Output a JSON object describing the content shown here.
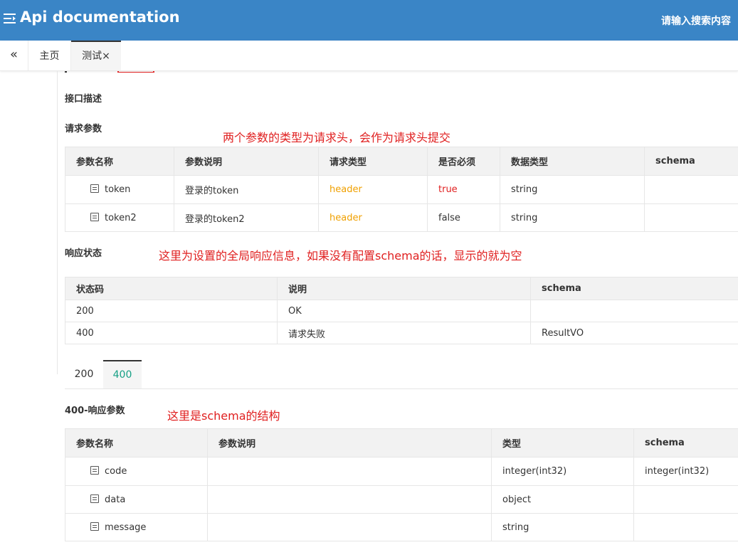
{
  "header": {
    "title": "Api documentation",
    "search_placeholder": "请输入搜索内容"
  },
  "tabs": {
    "collapse_icon": "double-chevron-left-icon",
    "home": "主页",
    "test": "测试×"
  },
  "sections": {
    "description": "接口描述",
    "request_params": "请求参数",
    "response_status": "响应状态",
    "response_params": "400-响应参数"
  },
  "annotations": {
    "request_note": "两个参数的类型为请求头，会作为请求头提交",
    "status_note": "这里为设置的全局响应信息，如果没有配置schema的话，显示的就为空",
    "schema_note": "这里是schema的结构"
  },
  "request_table": {
    "headers": [
      "参数名称",
      "参数说明",
      "请求类型",
      "是否必须",
      "数据类型",
      "schema"
    ],
    "rows": [
      {
        "name": "token",
        "desc": "登录的token",
        "in": "header",
        "required": "true",
        "type": "string",
        "schema": ""
      },
      {
        "name": "token2",
        "desc": "登录的token2",
        "in": "header",
        "required": "false",
        "type": "string",
        "schema": ""
      }
    ]
  },
  "status_table": {
    "headers": [
      "状态码",
      "说明",
      "schema"
    ],
    "rows": [
      {
        "code": "200",
        "desc": "OK",
        "schema": ""
      },
      {
        "code": "400",
        "desc": "请求失败",
        "schema": "ResultVO"
      }
    ]
  },
  "status_tabs": [
    "200",
    "400"
  ],
  "response_table": {
    "headers": [
      "参数名称",
      "参数说明",
      "类型",
      "schema"
    ],
    "rows": [
      {
        "name": "code",
        "desc": "",
        "type": "integer(int32)",
        "schema": "integer(int32)"
      },
      {
        "name": "data",
        "desc": "",
        "type": "object",
        "schema": ""
      },
      {
        "name": "message",
        "desc": "",
        "type": "string",
        "schema": ""
      }
    ]
  },
  "colors": {
    "header_bg": "#3a85c6",
    "annotation_red": "#e02020",
    "header_type_orange": "#f0a000",
    "active_tab_teal": "#16a085"
  }
}
